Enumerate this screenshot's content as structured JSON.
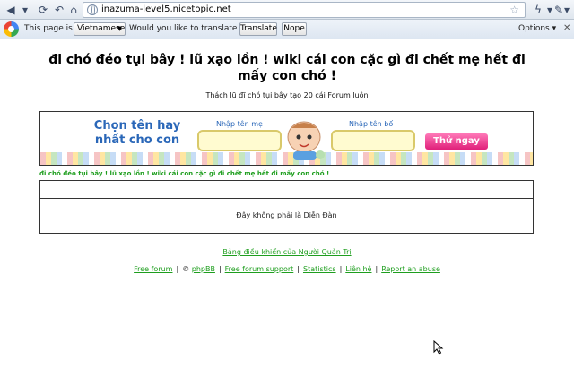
{
  "browser": {
    "url_scheme": "",
    "url_host": "inazuma-level5",
    "url_rest": ".nicetopic.net"
  },
  "translate_bar": {
    "prefix": "This page is in",
    "language": "Vietnamese",
    "question": "Would you like to translate it?",
    "translate_label": "Translate",
    "nope_label": "Nope",
    "options_label": "Options"
  },
  "page": {
    "headline": "đi chó đéo tụi bây ! lũ xạo lồn ! wiki cái con cặc gì đi chết mẹ hết đi mấy con chó !",
    "subline": "Thách lũ đĩ chó tụi bây tạo 20 cái Forum luôn",
    "forum_title": "đi chó đéo tụi bây ! lũ xạo lồn ! wiki cái con cặc gì đi chết mẹ hết đi mấy con chó !",
    "box_message": "Đây không phải là Diễn Đàn",
    "admin_link": "Bảng điều khiển của Người Quản Trị"
  },
  "banner": {
    "slogan": "Chọn tên hay nhất cho con",
    "mother_label": "Nhập tên mẹ",
    "father_label": "Nhập tên bố",
    "try_label": "Thử ngay"
  },
  "footer": {
    "free_forum": "Free forum",
    "copyright": "©",
    "phpbb": "phpBB",
    "free_forum_support": "Free forum support",
    "statistics": "Statistics",
    "contact": "Liên hệ",
    "report_abuse": "Report an abuse"
  }
}
